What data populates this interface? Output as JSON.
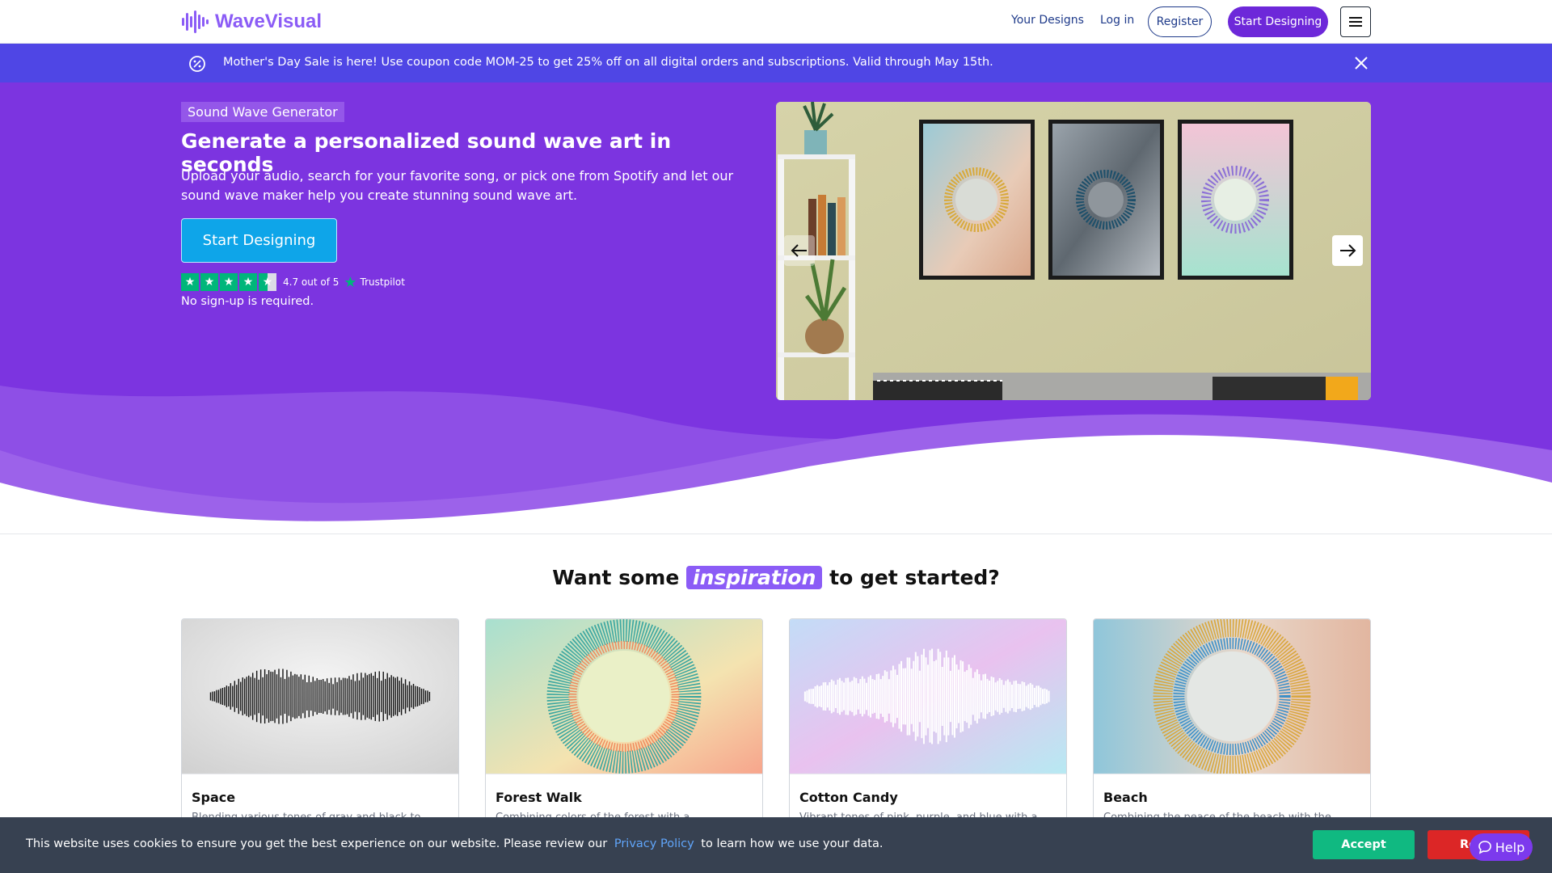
{
  "header": {
    "logo_text": "WaveVisual",
    "nav_your_designs": "Your Designs",
    "nav_login": "Log in",
    "register_label": "Register",
    "start_label": "Start Designing",
    "menu_icon": "hamburger-icon"
  },
  "promo": {
    "icon": "discount-icon",
    "text": "Mother's Day Sale is here! Use coupon code MOM-25 to get 25% off on all digital orders and subscriptions. Valid through May 15th.",
    "close_icon": "close-icon"
  },
  "hero": {
    "badge": "Sound Wave Generator",
    "title": "Generate a personalized sound wave art in seconds",
    "subtitle": "Upload your audio, search for your favorite song, or pick one from Spotify and let our sound wave maker help you create stunning sound wave art.",
    "cta_label": "Start Designing",
    "rating_text": "4.7 out of 5",
    "rating_value": 4.7,
    "trustpilot": "Trustpilot",
    "no_signup": "No sign-up is required."
  },
  "inspiration": {
    "title_before": "Want some",
    "title_highlight": "inspiration",
    "title_after": "to get started?",
    "cards": [
      {
        "title": "Space",
        "desc": "Blending various tones of gray and black to"
      },
      {
        "title": "Forest Walk",
        "desc": "Combining colors of the forest with a"
      },
      {
        "title": "Cotton Candy",
        "desc": "Vibrant tones of pink, purple, and blue with a"
      },
      {
        "title": "Beach",
        "desc": "Combining the peace of the beach with the"
      }
    ]
  },
  "cookie": {
    "text_before": "This website uses cookies to ensure you get the best experience on our website. Please review our",
    "link": "Privacy Policy",
    "text_after": "to learn how we use your data.",
    "accept_label": "Accept",
    "reject_label": "Re"
  },
  "help": {
    "label": "Help",
    "icon": "chat-icon"
  },
  "colors": {
    "brand": "#8b5cf6",
    "hero_bg": "#7c34e0",
    "promo_bg": "#4f46e5",
    "cta": "#0ea5e9",
    "accept": "#10b981",
    "reject": "#dc2626"
  }
}
